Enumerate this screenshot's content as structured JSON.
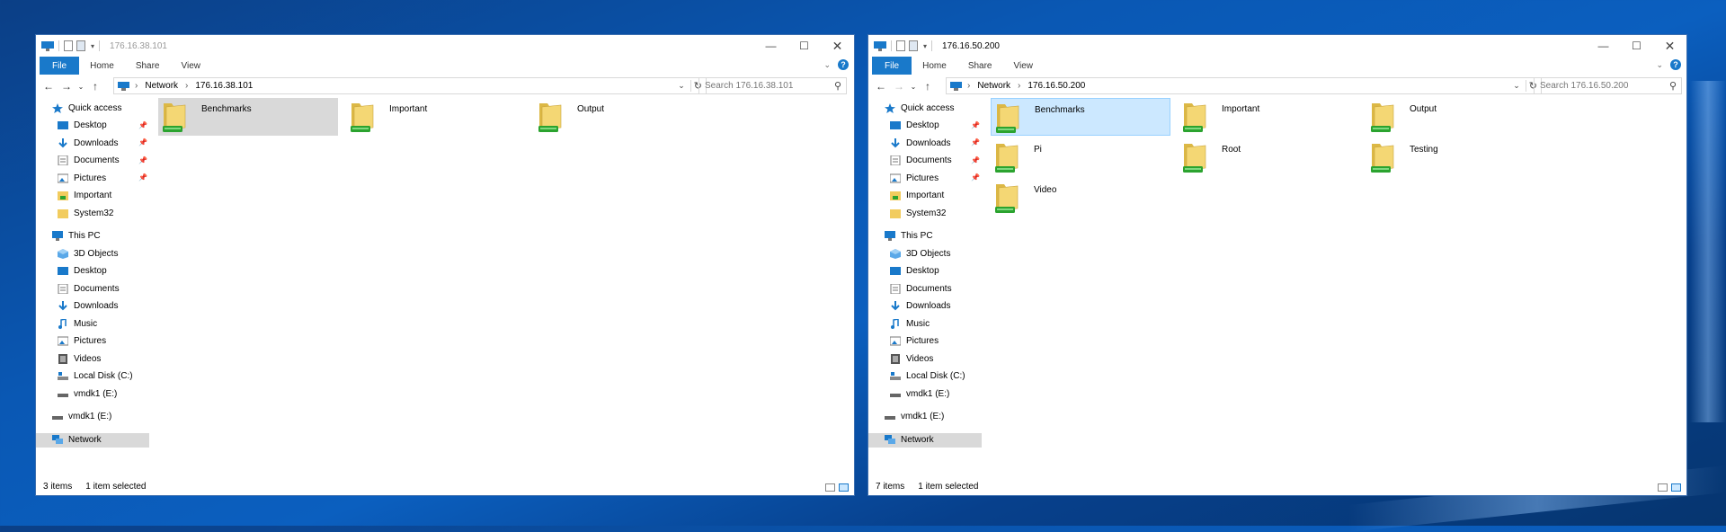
{
  "colors": {
    "accent": "#1979ca",
    "selection_blue": "#cce8ff",
    "selection_gray": "#d9d9d9"
  },
  "windows": [
    {
      "title": "176.16.38.101",
      "active": false,
      "ribbon_tabs": [
        "File",
        "Home",
        "Share",
        "View"
      ],
      "address": {
        "root": "Network",
        "location": "176.16.38.101"
      },
      "search_placeholder": "Search 176.16.38.101",
      "quick_access_label": "Quick access",
      "quick_access": [
        "Desktop",
        "Downloads",
        "Documents",
        "Pictures",
        "Important",
        "System32"
      ],
      "this_pc_label": "This PC",
      "this_pc": [
        "3D Objects",
        "Desktop",
        "Documents",
        "Downloads",
        "Music",
        "Pictures",
        "Videos",
        "Local Disk (C:)",
        "vmdk1 (E:)"
      ],
      "drive_label": "vmdk1 (E:)",
      "network_label": "Network",
      "items": [
        "Benchmarks",
        "Important",
        "Output"
      ],
      "selected_item": "Benchmarks",
      "status": {
        "count": "3 items",
        "selection": "1 item selected"
      }
    },
    {
      "title": "176.16.50.200",
      "active": true,
      "ribbon_tabs": [
        "File",
        "Home",
        "Share",
        "View"
      ],
      "address": {
        "root": "Network",
        "location": "176.16.50.200"
      },
      "search_placeholder": "Search 176.16.50.200",
      "quick_access_label": "Quick access",
      "quick_access": [
        "Desktop",
        "Downloads",
        "Documents",
        "Pictures",
        "Important",
        "System32"
      ],
      "this_pc_label": "This PC",
      "this_pc": [
        "3D Objects",
        "Desktop",
        "Documents",
        "Downloads",
        "Music",
        "Pictures",
        "Videos",
        "Local Disk (C:)",
        "vmdk1 (E:)"
      ],
      "drive_label": "vmdk1 (E:)",
      "network_label": "Network",
      "items": [
        "Benchmarks",
        "Important",
        "Output",
        "Pi",
        "Root",
        "Testing",
        "Video"
      ],
      "selected_item": "Benchmarks",
      "status": {
        "count": "7 items",
        "selection": "1 item selected"
      }
    }
  ],
  "icons": {
    "window_controls": [
      "minimize-icon",
      "maximize-icon",
      "close-icon"
    ],
    "nav": [
      "back-arrow-icon",
      "forward-arrow-icon",
      "recent-chevron-icon",
      "up-arrow-icon"
    ]
  }
}
